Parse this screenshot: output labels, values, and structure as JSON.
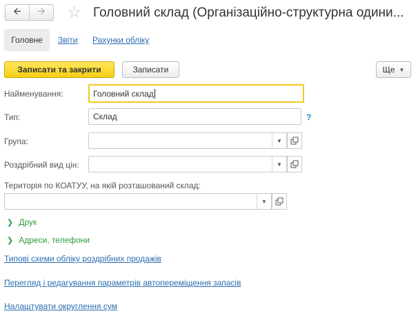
{
  "header": {
    "title": "Головний склад (Організаційно-структурна одини...",
    "back_icon": "arrow-left-icon",
    "forward_icon": "arrow-right-icon",
    "favorite_icon": "star-icon"
  },
  "tabs": [
    {
      "label": "Головне",
      "active": true
    },
    {
      "label": "Звіти",
      "active": false
    },
    {
      "label": "Рахунки обліку",
      "active": false
    }
  ],
  "toolbar": {
    "save_close_label": "Записати та закрити",
    "save_label": "Записати",
    "more_label": "Ще"
  },
  "form": {
    "name": {
      "label": "Найменування:",
      "value": "Головний склад"
    },
    "type": {
      "label": "Тип:",
      "value": "Склад",
      "help": "?"
    },
    "group": {
      "label": "Група:",
      "value": ""
    },
    "price_type": {
      "label": "Роздрібний вид цін:",
      "value": ""
    },
    "territory": {
      "label": "Територія по КОАТУУ, на якій розташований склад:",
      "value": ""
    }
  },
  "groups": {
    "print": "Друк",
    "addresses": "Адреси, телефони"
  },
  "links": {
    "retail_schemes": "Типові схеми обліку роздрібних продажів",
    "auto_transfer": "Перегляд і редагування параметрів автопереміщення запасів",
    "rounding": "Налаштувати округлення сум"
  },
  "colors": {
    "accent_yellow": "#f5cf16",
    "focus_border": "#f2c81c",
    "link_blue": "#2b6cb0",
    "group_green": "#2e9a3c"
  }
}
